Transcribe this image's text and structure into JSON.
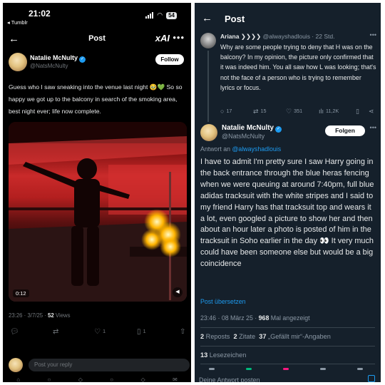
{
  "left": {
    "status": {
      "time": "21:02",
      "back_app": "◂ Tumblr",
      "battery": "54"
    },
    "header": {
      "title": "Post",
      "grok_icon": "xAI"
    },
    "post": {
      "name": "Natalie McNulty",
      "handle": "@NatsMcNulty",
      "follow_label": "Follow",
      "text": "Guess who I saw sneaking into the venue last night 🥹💚 So so happy we got up to the balcony in search of the smoking area, best night ever; life now complete.",
      "video_time": "0:12",
      "meta_time": "23:26 · 3/7/25 · ",
      "views_count": "52",
      "views_label": " Views",
      "likes": "1",
      "bookmarks": "1"
    },
    "reply_placeholder": "Post your reply"
  },
  "right": {
    "header": {
      "title": "Post"
    },
    "parent": {
      "name": "Ariana ❯❯❯❯",
      "handle_time": " @alwayshadlouis · 22 Std.",
      "text": "Why are some people trying to deny that H was on the balcony? In my opinion, the picture only confirmed that it was indeed him. You all saw how L was looking; that's not the face of a person who is trying to remember lyrics or focus.",
      "replies": "17",
      "reposts": "15",
      "likes": "351",
      "views": "11,2K"
    },
    "post": {
      "name": "Natalie McNulty",
      "handle": "@NatsMcNulty",
      "follow_label": "Folgen",
      "replying_prefix": "Antwort an ",
      "replying_handle": "@alwayshadlouis",
      "text": "I have to admit I'm pretty sure I saw Harry going in the back entrance through the blue heras fencing when we were queuing at around 7:40pm, full blue adidas tracksuit with the white stripes and I said to my friend Harry has that tracksuit top and wears it a lot, even googled a picture to show her and then about an hour later a photo is posted of him in the tracksuit in Soho earlier in the day 👀 It very much could have been someone else but would be a big coincidence",
      "translate": "Post übersetzen",
      "meta_time": "23:46 · 08 März 25 · ",
      "views_count": "968",
      "views_label": " Mal angezeigt",
      "reposts_count": "2",
      "reposts_label": " Reposts",
      "quotes_count": "2",
      "quotes_label": " Zitate",
      "likes_count": "37",
      "likes_label": " „Gefällt mir“-Angaben",
      "bookmarks_count": "13",
      "bookmarks_label": " Lesezeichen"
    },
    "compose_placeholder": "Deine Antwort posten"
  },
  "colors": {
    "accent": "#1d9bf0",
    "left_bg": "#000000",
    "right_bg": "#15202b"
  }
}
